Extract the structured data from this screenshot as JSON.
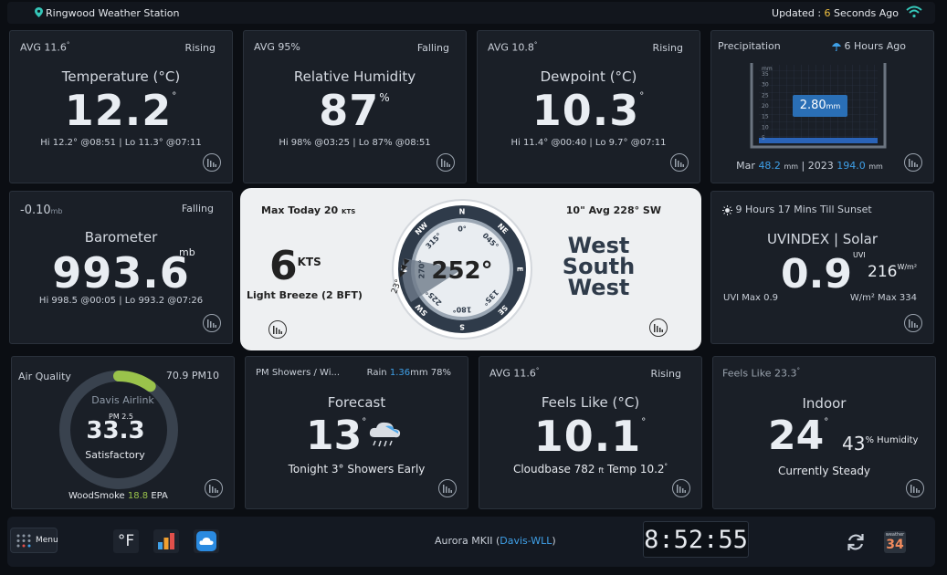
{
  "header": {
    "station": "Ringwood Weather Station",
    "updated_prefix": "Updated : ",
    "updated_num": "6",
    "updated_suffix": " Seconds Ago"
  },
  "temperature": {
    "avg": "AVG 11.6",
    "trend": "Rising",
    "title": "Temperature (°C)",
    "value": "12.2",
    "hilo": "Hi 12.2° @08:51 | Lo 11.3° @07:11"
  },
  "humidity": {
    "avg": "AVG 95",
    "avg_unit": "%",
    "trend": "Falling",
    "title": "Relative Humidity",
    "value": "87",
    "unit": "%",
    "hilo": "Hi 98% @03:25 | Lo 87% @08:51"
  },
  "dewpoint": {
    "avg": "AVG 10.8",
    "trend": "Rising",
    "title": "Dewpoint (°C)",
    "value": "10.3",
    "hilo": "Hi 11.4° @00:40 | Lo 9.7° @07:11"
  },
  "precip": {
    "title": "Precipitation",
    "ago": "6 Hours Ago",
    "reading": "2.80",
    "reading_unit": "mm",
    "axis_unit": "mm",
    "ticks": [
      "35",
      "30",
      "25",
      "20",
      "15",
      "10",
      "5"
    ],
    "fill_level": 0.05,
    "month_label": "Mar",
    "month_value": "48.2",
    "year_label": "2023",
    "year_value": "194.0",
    "unit": "mm"
  },
  "barometer": {
    "delta": "-0.10",
    "delta_unit": "mb",
    "trend": "Falling",
    "title": "Barometer",
    "unit": "mb",
    "value": "993.6",
    "hilo": "Hi 998.5 @00:05 | Lo 993.2 @07:26"
  },
  "wind": {
    "max_today": "Max Today 20",
    "max_unit": "KTS",
    "avg": "10\" Avg 228° SW",
    "speed": "6",
    "speed_unit": "KTS",
    "desc": "Light Breeze (2 BFT)",
    "bearing": "252°",
    "dir1": "West",
    "dir2": "South",
    "dir3": "West",
    "compass": [
      "N",
      "NE",
      "E",
      "SE",
      "S",
      "SW",
      "W",
      "NW"
    ],
    "degrees": [
      "0°",
      "045°",
      "135°",
      "180°",
      "225°",
      "270°",
      "315°"
    ],
    "gust_label": "23°"
  },
  "solar": {
    "sunset": "9 Hours 17 Mins Till Sunset",
    "title": "UVINDEX | Solar",
    "uvi": "0.9",
    "uvi_unit": "UVI",
    "solar": "216",
    "solar_unit": "W/m²",
    "uvi_max": "UVI Max 0.9",
    "solar_max": "W/m² Max 334"
  },
  "air": {
    "title": "Air Quality",
    "pm10": "70.9 PM10",
    "source": "Davis Airlink",
    "pm_label": "PM 2.5",
    "value": "33.3",
    "status": "Satisfactory",
    "ring_fraction": 0.1,
    "smoke_prefix": "WoodSmoke",
    "smoke_value": "18.8",
    "smoke_suffix": "EPA"
  },
  "forecast": {
    "summary": "PM Showers / Wi...",
    "rain_prefix": "Rain",
    "rain_value": "1.36",
    "rain_suffix": "mm 78%",
    "title": "Forecast",
    "value": "13",
    "tonight": "Tonight 3° Showers Early"
  },
  "feels": {
    "avg": "AVG 11.6",
    "trend": "Rising",
    "title": "Feels Like (°C)",
    "value": "10.1",
    "cloudbase": "Cloudbase 782",
    "cloudbase_unit": "ft",
    "temp": "Temp 10.2"
  },
  "indoor": {
    "feels": "Feels Like 23.3",
    "title": "Indoor",
    "value": "24",
    "humidity": "43",
    "humidity_unit": "% Humidity",
    "status": "Currently Steady"
  },
  "footer": {
    "menu": "Menu",
    "units": "°F",
    "station_prefix": "Aurora MKII (",
    "station_link": "Davis-WLL",
    "station_suffix": ")",
    "clock": "8:52:55",
    "cal_month": "weather",
    "cal_day": "34"
  },
  "colors": {
    "bg": "#0b0e13",
    "card": "#1a1f27",
    "accent_blue": "#3fa0e8",
    "accent_yellow": "#f0c040",
    "accent_green": "#9ac34b",
    "compass_dark": "#2f3b4a"
  }
}
